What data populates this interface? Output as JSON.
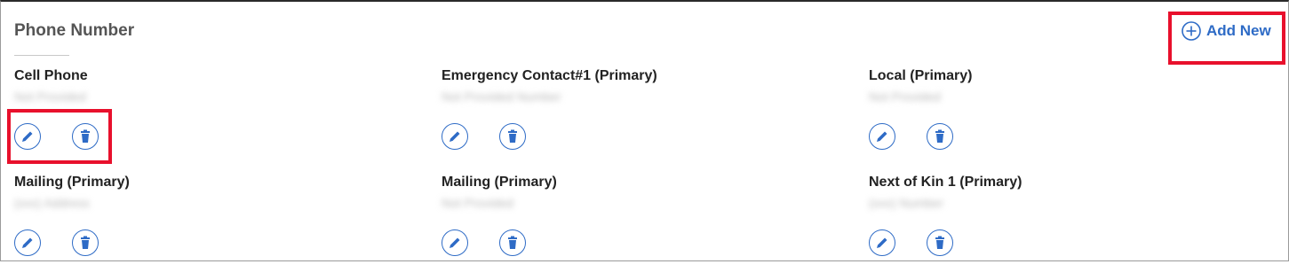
{
  "section": {
    "title": "Phone Number",
    "add_new_label": "Add New"
  },
  "phones": [
    {
      "label": "Cell Phone",
      "value": "Not Provided"
    },
    {
      "label": "Emergency Contact#1 (Primary)",
      "value": "Not Provided Number"
    },
    {
      "label": "Local (Primary)",
      "value": "Not Provided"
    },
    {
      "label": "Mailing (Primary)",
      "value": "(xxx) Address"
    },
    {
      "label": "Mailing (Primary)",
      "value": "Not Provided"
    },
    {
      "label": "Next of Kin 1 (Primary)",
      "value": "(xxx) Number"
    }
  ],
  "colors": {
    "accent": "#2e6bc6",
    "highlight": "#e8102c"
  },
  "icons": {
    "add": "plus-circle-icon",
    "edit": "pencil-icon",
    "delete": "trash-icon"
  }
}
